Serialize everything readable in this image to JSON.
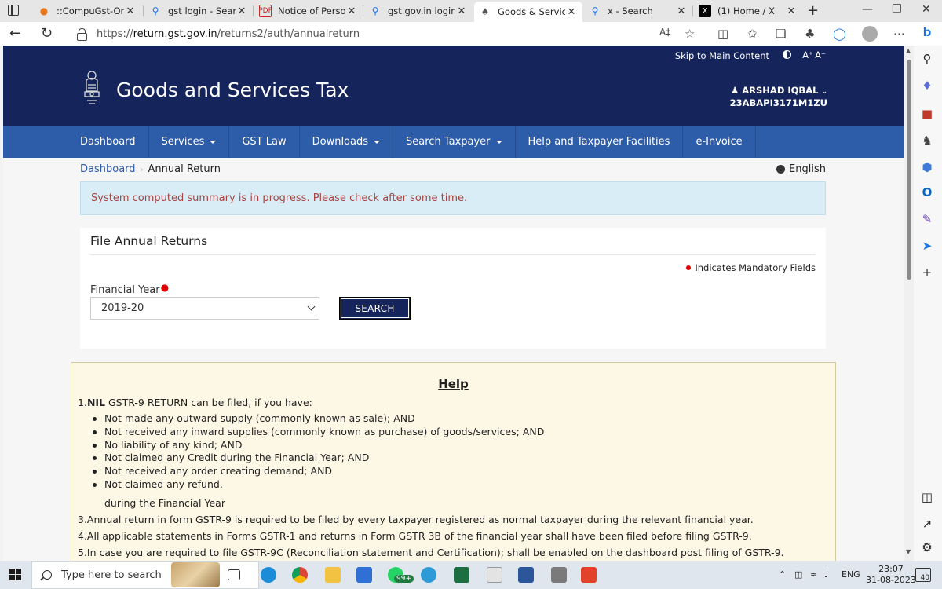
{
  "browser": {
    "tabs": [
      {
        "title": "::CompuGst-Online",
        "icon": "compugst-icon",
        "color": "#e8761b"
      },
      {
        "title": "gst login - Search",
        "icon": "search-icon",
        "color": "#1a73e8"
      },
      {
        "title": "Notice of Personal",
        "icon": "pdf-icon",
        "color": "#c62828"
      },
      {
        "title": "gst.gov.in login - Se",
        "icon": "search-icon",
        "color": "#1a73e8"
      },
      {
        "title": "Goods & Service Ta",
        "icon": "emblem-icon",
        "color": "#555555"
      },
      {
        "title": "x - Search",
        "icon": "search-icon",
        "color": "#1a73e8"
      },
      {
        "title": "(1) Home / X",
        "icon": "x-icon",
        "color": "#000000"
      }
    ],
    "active_tab": 4,
    "url_prefix": "https://",
    "url_host": "return.gst.gov.in",
    "url_path": "/returns2/auth/annualreturn"
  },
  "header": {
    "skip_link": "Skip to Main Content",
    "font_increase": "A⁺",
    "font_decrease": "A⁻",
    "site_title": "Goods and Services Tax",
    "user_name": "ARSHAD IQBAL",
    "gstin": "23ABAPI3171M1ZU"
  },
  "menu": [
    {
      "label": "Dashboard",
      "dropdown": false
    },
    {
      "label": "Services",
      "dropdown": true
    },
    {
      "label": "GST Law",
      "dropdown": false
    },
    {
      "label": "Downloads",
      "dropdown": true
    },
    {
      "label": "Search Taxpayer",
      "dropdown": true
    },
    {
      "label": "Help and Taxpayer Facilities",
      "dropdown": false
    },
    {
      "label": "e-Invoice",
      "dropdown": false
    }
  ],
  "breadcrumb": {
    "home": "Dashboard",
    "current": "Annual Return"
  },
  "language": "English",
  "alert": {
    "message": "System computed summary is in progress. Please check after some time."
  },
  "panel": {
    "title": "File Annual Returns",
    "mandatory_note": "Indicates Mandatory Fields",
    "fy_label": "Financial Year",
    "fy_value": "2019-20",
    "search_button": "SEARCH"
  },
  "help": {
    "title": "Help",
    "line1_num": "1.",
    "line1_bold": "NIL",
    "line1_rest": " GSTR-9 RETURN can be filed, if you have:",
    "bullets": [
      "Not made any outward supply (commonly known as sale); AND",
      "Not received any inward supplies (commonly known as purchase) of goods/services; AND",
      "No liability of any kind; AND",
      "Not claimed any Credit during the Financial Year; AND",
      "Not received any order creating demand; AND",
      "Not claimed any refund."
    ],
    "sub_note": "during the Financial Year",
    "points": [
      "3.Annual return in form GSTR-9 is required to be filed by every taxpayer registered as normal taxpayer during the relevant financial year.",
      "4.All applicable statements in Forms GSTR-1 and returns in Form GSTR 3B of the financial year shall have been filed before filing GSTR-9.",
      "5.In case you are required to file GSTR-9C (Reconciliation statement and Certification); shall be enabled on the dashboard post filing of GSTR-9."
    ]
  },
  "taskbar": {
    "search_placeholder": "Type here to search",
    "whatsapp_badge": "99+",
    "language": "ENG",
    "time": "23:07",
    "date": "31-08-2023",
    "notification_count": "40"
  },
  "colors": {
    "header_bg": "#15245a",
    "menu_bg": "#2d5ca8",
    "alert_text": "#a94442",
    "alert_bg": "#d9edf7",
    "help_bg": "#fdf8e6"
  }
}
